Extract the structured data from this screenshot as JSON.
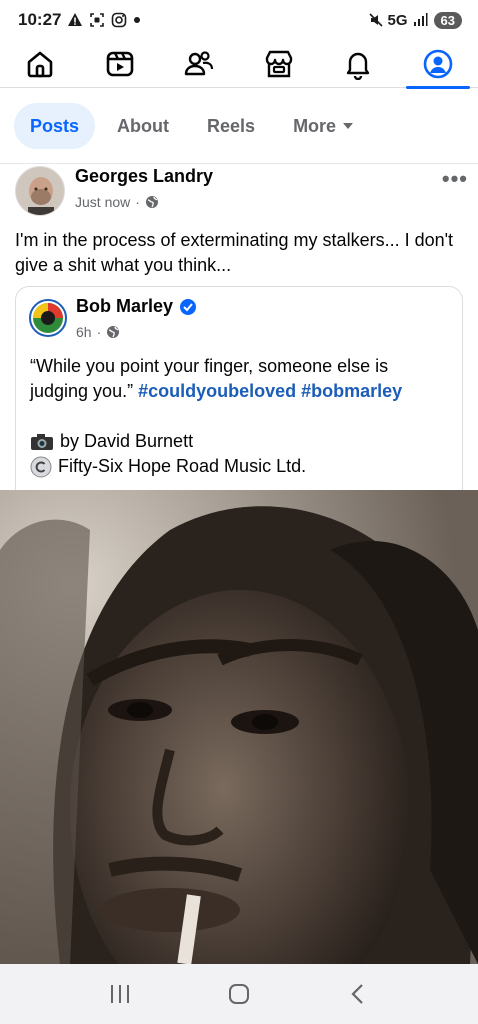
{
  "status": {
    "time": "10:27",
    "network": "5G",
    "battery": "63",
    "icons": [
      "warning-icon",
      "screenshot-icon",
      "instagram-icon",
      "dot-icon",
      "mute-icon",
      "signal-icon"
    ]
  },
  "nav": {
    "items": [
      {
        "name": "home",
        "icon": "home-icon"
      },
      {
        "name": "video",
        "icon": "video-icon"
      },
      {
        "name": "friends",
        "icon": "friends-icon"
      },
      {
        "name": "marketplace",
        "icon": "marketplace-icon"
      },
      {
        "name": "notifications",
        "icon": "bell-icon"
      },
      {
        "name": "profile",
        "icon": "profile-icon"
      }
    ],
    "active": "profile",
    "accent": "#0866ff"
  },
  "tabs": {
    "posts": "Posts",
    "about": "About",
    "reels": "Reels",
    "more": "More"
  },
  "post": {
    "author": "Georges Landry",
    "time": "Just now",
    "separator": "·",
    "text": "I'm in the process of exterminating my stalkers... I don't give a shit what you think...",
    "shared": {
      "page_name": "Bob Marley",
      "time": "6h",
      "separator": "·",
      "quote_plain": "“While you point your finger, someone else is judging you.” ",
      "hashtag1": "#couldyoubeloved",
      "hashtag2": "#bobmarley",
      "credit_photo": "by David Burnett",
      "credit_copyright": "Fifty-Six Hope Road Music Ltd.",
      "link_color": "#1b5db8"
    }
  }
}
